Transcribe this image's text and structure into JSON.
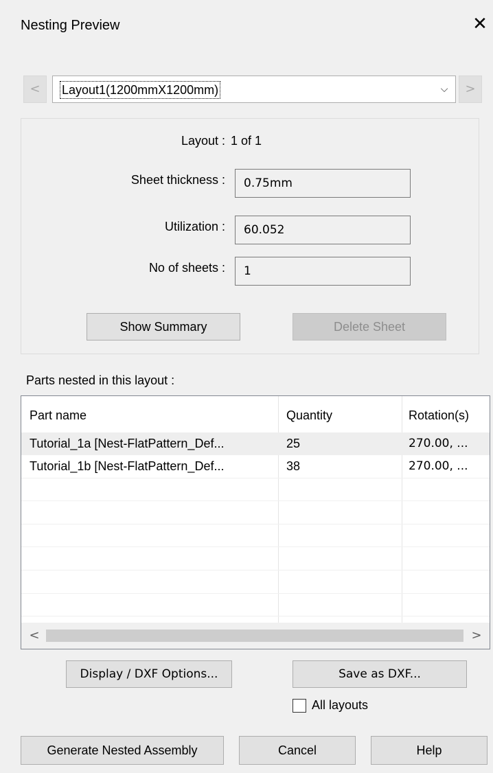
{
  "dialog": {
    "title": "Nesting Preview",
    "close_glyph": "✕"
  },
  "nav": {
    "prev_glyph": "<",
    "next_glyph": ">",
    "layout_selected": "Layout1(1200mmX1200mm)",
    "dropdown_glyph": "⌵"
  },
  "info": {
    "layout_label": "Layout :",
    "layout_value": "1 of 1",
    "thickness_label": "Sheet thickness :",
    "thickness_value": "0.75mm",
    "utilization_label": "Utilization :",
    "utilization_value": "60.052",
    "sheets_label": "No of sheets :",
    "sheets_value": "1",
    "show_summary": "Show Summary",
    "delete_sheet": "Delete Sheet"
  },
  "parts": {
    "caption": "Parts nested in this layout :",
    "columns": [
      "Part name",
      "Quantity",
      "Rotation(s)"
    ],
    "rows": [
      {
        "name": "Tutorial_1a [Nest-FlatPattern_Def...",
        "quantity": "25",
        "rotation": "270.00, ..."
      },
      {
        "name": "Tutorial_1b [Nest-FlatPattern_Def...",
        "quantity": "38",
        "rotation": "270.00, ..."
      }
    ],
    "scroll_left": "<",
    "scroll_right": ">"
  },
  "actions": {
    "display_dxf_options": "Display / DXF Options...",
    "save_as_dxf": "Save as DXF...",
    "all_layouts_label": "All layouts",
    "all_layouts_checked": false,
    "generate": "Generate Nested Assembly",
    "cancel": "Cancel",
    "help": "Help"
  }
}
